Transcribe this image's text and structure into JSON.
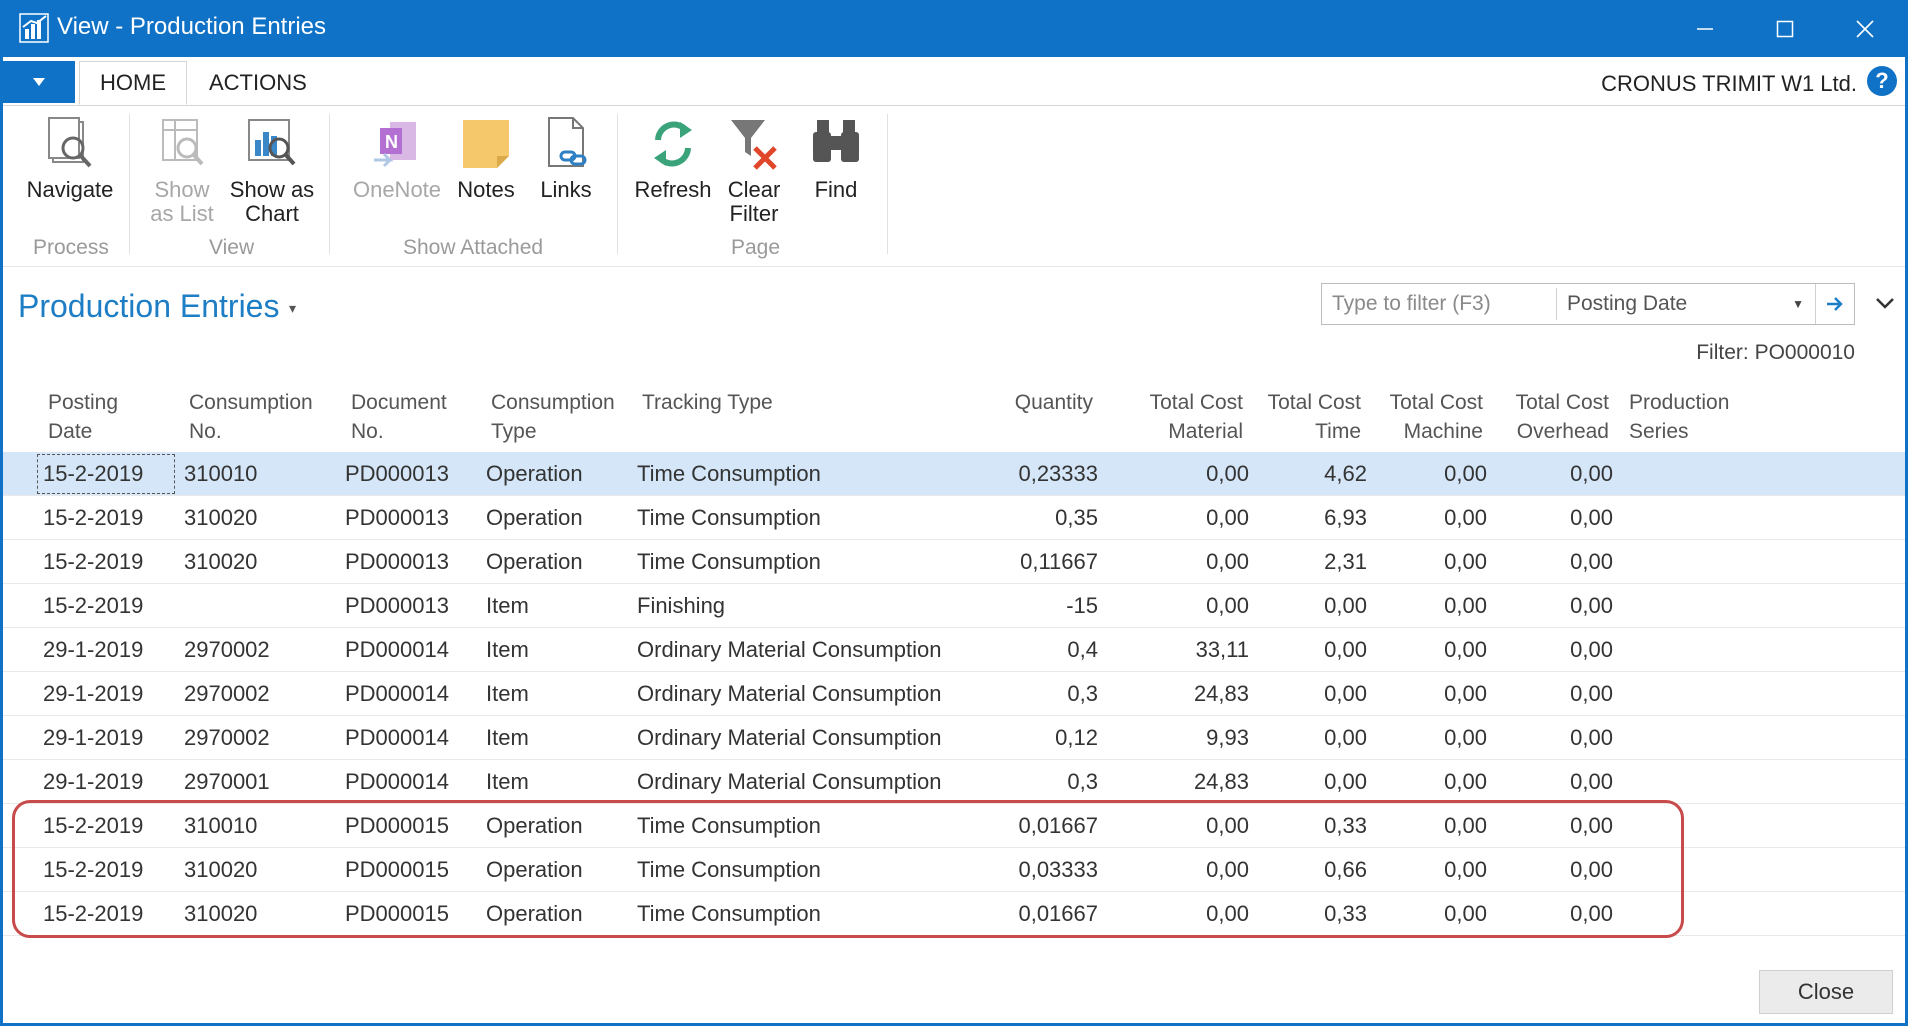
{
  "window": {
    "title": "View - Production Entries"
  },
  "tabs": {
    "home": "HOME",
    "actions": "ACTIONS"
  },
  "company": "CRONUS TRIMIT W1 Ltd.",
  "ribbon": {
    "navigate": "Navigate",
    "show_as_list_1": "Show",
    "show_as_list_2": "as List",
    "show_as_chart_1": "Show as",
    "show_as_chart_2": "Chart",
    "onenote": "OneNote",
    "notes": "Notes",
    "links": "Links",
    "refresh": "Refresh",
    "clear_filter_1": "Clear",
    "clear_filter_2": "Filter",
    "find": "Find",
    "groups": {
      "process": "Process",
      "view": "View",
      "show_attached": "Show Attached",
      "page": "Page"
    }
  },
  "page": {
    "title": "Production Entries",
    "filter_placeholder": "Type to filter (F3)",
    "filter_field": "Posting Date",
    "filter_text": "Filter: PO000010"
  },
  "table": {
    "headers": {
      "posting_date": [
        "Posting",
        "Date"
      ],
      "consumption_no": [
        "Consumption",
        "No."
      ],
      "document_no": [
        "Document",
        "No."
      ],
      "consumption_type": [
        "Consumption",
        "Type"
      ],
      "tracking_type": [
        "Tracking Type"
      ],
      "quantity": [
        "Quantity"
      ],
      "total_cost_material": [
        "Total Cost",
        "Material"
      ],
      "total_cost_time": [
        "Total Cost",
        "Time"
      ],
      "total_cost_machine": [
        "Total Cost",
        "Machine"
      ],
      "total_cost_overhead": [
        "Total Cost",
        "Overhead"
      ],
      "production_series": [
        "Production",
        "Series"
      ]
    },
    "rows": [
      [
        "15-2-2019",
        "310010",
        "PD000013",
        "Operation",
        "Time Consumption",
        "0,23333",
        "0,00",
        "4,62",
        "0,00",
        "0,00",
        ""
      ],
      [
        "15-2-2019",
        "310020",
        "PD000013",
        "Operation",
        "Time Consumption",
        "0,35",
        "0,00",
        "6,93",
        "0,00",
        "0,00",
        ""
      ],
      [
        "15-2-2019",
        "310020",
        "PD000013",
        "Operation",
        "Time Consumption",
        "0,11667",
        "0,00",
        "2,31",
        "0,00",
        "0,00",
        ""
      ],
      [
        "15-2-2019",
        "",
        "PD000013",
        "Item",
        "Finishing",
        "-15",
        "0,00",
        "0,00",
        "0,00",
        "0,00",
        ""
      ],
      [
        "29-1-2019",
        "2970002",
        "PD000014",
        "Item",
        "Ordinary Material Consumption",
        "0,4",
        "33,11",
        "0,00",
        "0,00",
        "0,00",
        ""
      ],
      [
        "29-1-2019",
        "2970002",
        "PD000014",
        "Item",
        "Ordinary Material Consumption",
        "0,3",
        "24,83",
        "0,00",
        "0,00",
        "0,00",
        ""
      ],
      [
        "29-1-2019",
        "2970002",
        "PD000014",
        "Item",
        "Ordinary Material Consumption",
        "0,12",
        "9,93",
        "0,00",
        "0,00",
        "0,00",
        ""
      ],
      [
        "29-1-2019",
        "2970001",
        "PD000014",
        "Item",
        "Ordinary Material Consumption",
        "0,3",
        "24,83",
        "0,00",
        "0,00",
        "0,00",
        ""
      ],
      [
        "15-2-2019",
        "310010",
        "PD000015",
        "Operation",
        "Time Consumption",
        "0,01667",
        "0,00",
        "0,33",
        "0,00",
        "0,00",
        ""
      ],
      [
        "15-2-2019",
        "310020",
        "PD000015",
        "Operation",
        "Time Consumption",
        "0,03333",
        "0,00",
        "0,66",
        "0,00",
        "0,00",
        ""
      ],
      [
        "15-2-2019",
        "310020",
        "PD000015",
        "Operation",
        "Time Consumption",
        "0,01667",
        "0,00",
        "0,33",
        "0,00",
        "0,00",
        ""
      ]
    ],
    "selected_row": 0
  },
  "footer": {
    "close": "Close"
  },
  "colors": {
    "accent": "#0f72c6",
    "title_blue": "#1d7ec5",
    "selection": "#d4e6f7",
    "highlight": "#c84a4a"
  },
  "icons": [
    "app-logo-icon",
    "minimize-icon",
    "maximize-icon",
    "close-icon",
    "menu-dropdown-icon",
    "help-icon",
    "navigate-icon",
    "show-as-list-icon",
    "show-as-chart-icon",
    "onenote-icon",
    "notes-icon",
    "links-icon",
    "refresh-icon",
    "clear-filter-icon",
    "find-binoculars-icon",
    "filter-go-arrow-icon",
    "collapse-chevron-icon"
  ]
}
